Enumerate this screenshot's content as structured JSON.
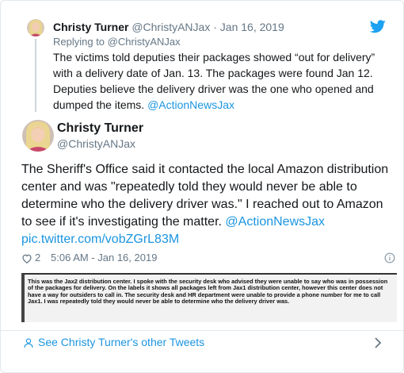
{
  "reply_tweet": {
    "name": "Christy Turner",
    "handle": "@ChristyANJax",
    "separator": " · ",
    "date": "Jan 16, 2019",
    "replying_to_label": "Replying to",
    "replying_to_handle": "@ChristyANJax",
    "text": "The victims told deputies their packages showed “out for delivery” with a delivery date of Jan. 13. The packages were found Jan 12. Deputies believe the delivery driver was the one who opened and dumped the items. ",
    "mention": "@ActionNewsJax"
  },
  "main_tweet": {
    "name": "Christy Turner",
    "handle": "@ChristyANJax",
    "text": "The Sheriff's Office said it contacted the local Amazon distribution center and was \"repeatedly told they would never be able to determine who the delivery driver was.\" I reached out to Amazon to see if it's investigating the matter. ",
    "mention": "@ActionNewsJax",
    "pic_link": "pic.twitter.com/vobZGrL83M",
    "like_count": "2",
    "timestamp": "5:06 AM - Jan 16, 2019",
    "image_text": "This was the Jax2 distribution center. I spoke with the security desk who advised they were unable to say who was in possession of the packages for delivery. On the labels it shows all packages left from Jax1 distribution center, however this center does not have a way for outsiders to call in. The security desk and HR department were unable to provide a phone number for me to call Jax1. I was repeatedly told they would never be able to determine who the delivery driver was."
  },
  "footer": {
    "see_more_label": "See Christy Turner's other Tweets"
  },
  "icons": {
    "twitter": "twitter-bird-icon",
    "like": "heart-icon",
    "info": "info-icon",
    "profile": "person-icon",
    "chevron": "chevron-right-icon"
  },
  "colors": {
    "link": "#1b95e0",
    "twitter_blue": "#1da1f2",
    "muted": "#657786",
    "text": "#14171a"
  }
}
